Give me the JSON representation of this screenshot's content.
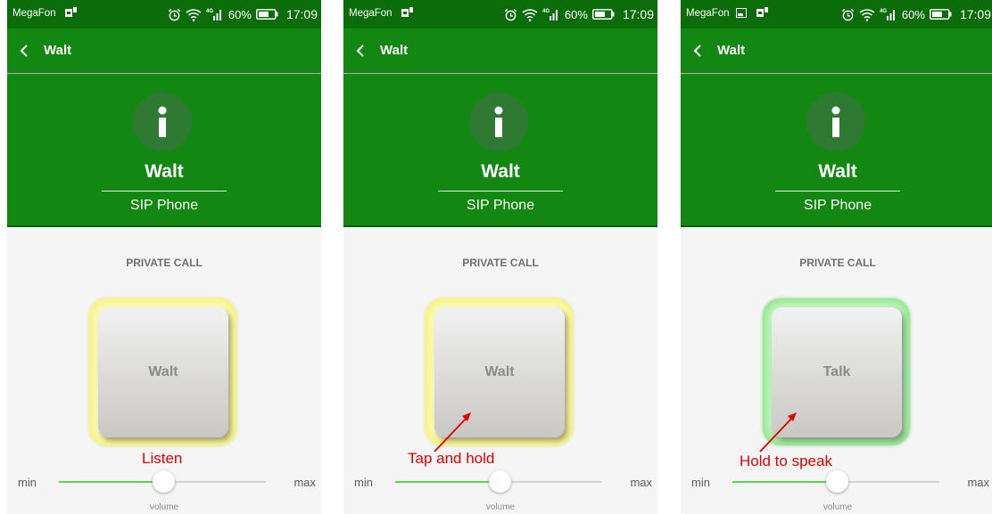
{
  "screens": [
    {
      "status": {
        "carrier": "MegaFon",
        "battery": "60%",
        "time": "17:09",
        "show_picture_icon": false
      },
      "appbar": {
        "title": "Walt"
      },
      "contact": {
        "name": "Walt",
        "type": "SIP Phone"
      },
      "section_label": "PRIVATE CALL",
      "ptt": {
        "label": "Walt",
        "glow_color": "#f6f57a",
        "state": "listening"
      },
      "annotation": {
        "text": "Listen",
        "has_arrow": false
      },
      "volume": {
        "min_label": "min",
        "max_label": "max",
        "label": "volume",
        "level": 0.5
      }
    },
    {
      "status": {
        "carrier": "MegaFon",
        "battery": "60%",
        "time": "17:09",
        "show_picture_icon": false
      },
      "appbar": {
        "title": "Walt"
      },
      "contact": {
        "name": "Walt",
        "type": "SIP Phone"
      },
      "section_label": "PRIVATE CALL",
      "ptt": {
        "label": "Walt",
        "glow_color": "#f6f57a",
        "state": "idle"
      },
      "annotation": {
        "text": "Tap and hold",
        "has_arrow": true
      },
      "volume": {
        "min_label": "min",
        "max_label": "max",
        "label": "volume",
        "level": 0.5
      }
    },
    {
      "status": {
        "carrier": "MegaFon",
        "battery": "60%",
        "time": "17:09",
        "show_picture_icon": true
      },
      "appbar": {
        "title": "Walt"
      },
      "contact": {
        "name": "Walt",
        "type": "SIP Phone"
      },
      "section_label": "PRIVATE CALL",
      "ptt": {
        "label": "Talk",
        "glow_color": "#8ee88c",
        "state": "talking"
      },
      "annotation": {
        "text": "Hold to speak",
        "has_arrow": true
      },
      "volume": {
        "min_label": "min",
        "max_label": "max",
        "label": "volume",
        "level": 0.5
      }
    }
  ],
  "colors": {
    "status_bar": "#0a6d0a",
    "app_bar": "#128812",
    "info_circle": "#2f7a33",
    "slider_fill": "#56d84a",
    "annotation": "#e00000"
  },
  "icons": [
    "sim-card-icon",
    "picture-icon",
    "alarm-icon",
    "wifi-icon",
    "signal-icon",
    "battery-icon",
    "back-arrow-icon",
    "info-icon"
  ]
}
